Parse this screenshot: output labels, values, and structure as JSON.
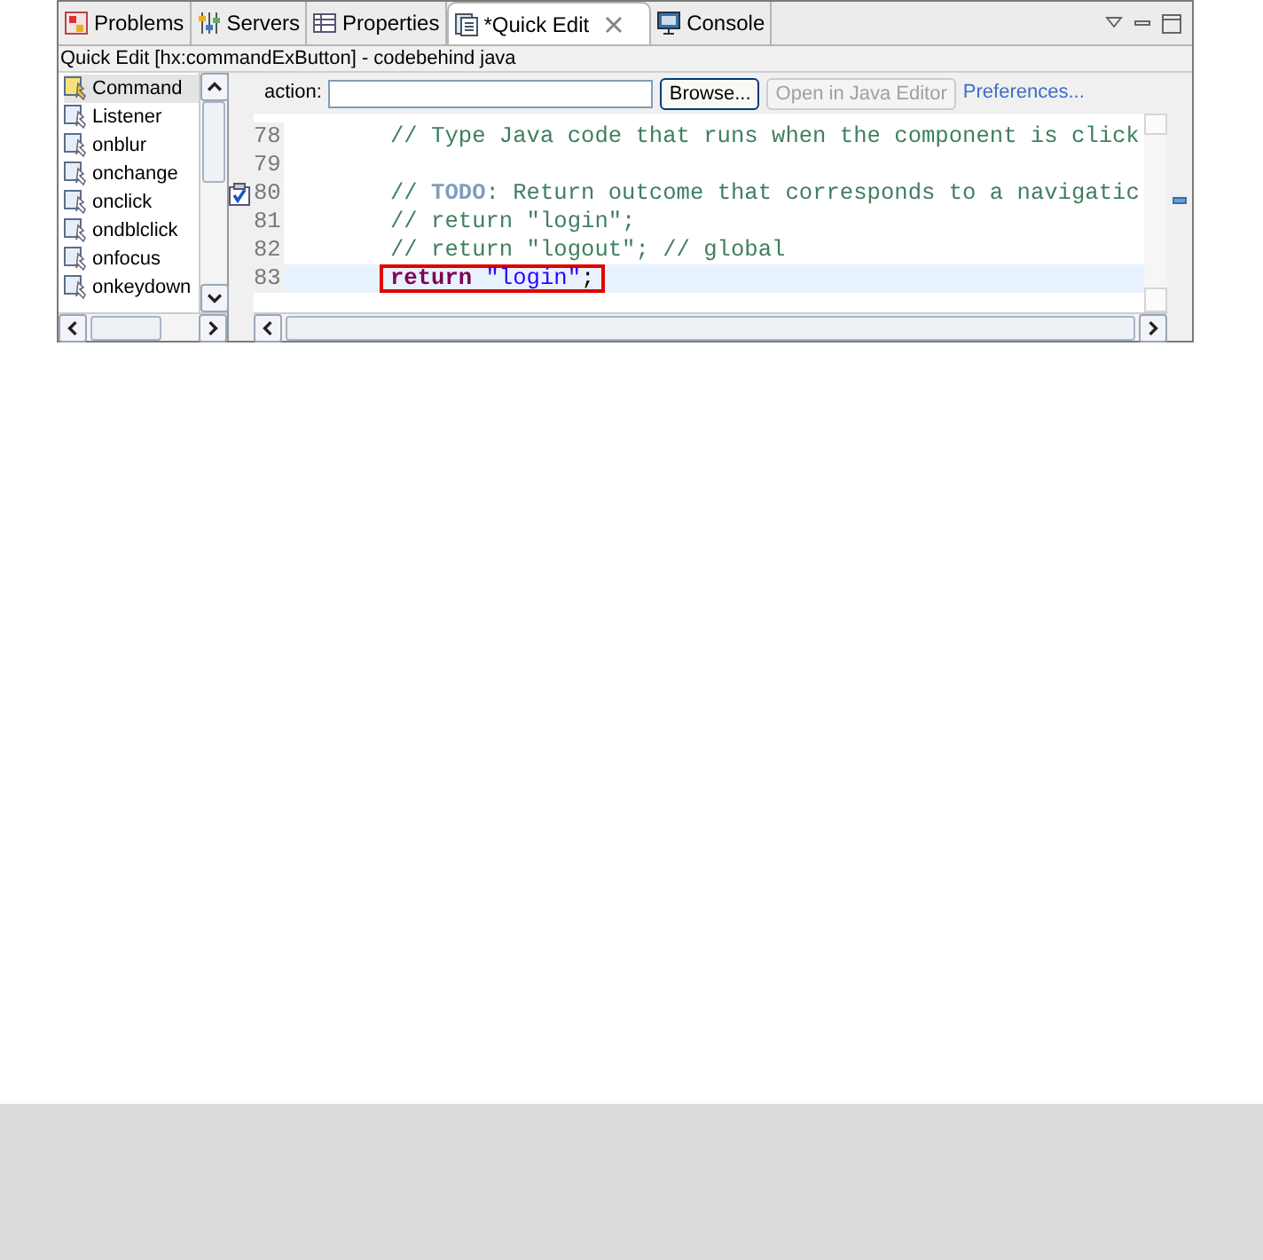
{
  "tabs": [
    {
      "label": "Problems",
      "kind": "problems",
      "selected": false,
      "closable": false
    },
    {
      "label": "Servers",
      "kind": "servers",
      "selected": false,
      "closable": false
    },
    {
      "label": "Properties",
      "kind": "properties",
      "selected": false,
      "closable": false
    },
    {
      "label": "*Quick Edit",
      "kind": "quickedit",
      "selected": true,
      "closable": true
    },
    {
      "label": "Console",
      "kind": "console",
      "selected": false,
      "closable": false
    }
  ],
  "view_title": "Quick Edit [hx:commandExButton] - codebehind java",
  "events": [
    {
      "label": "Command",
      "selected": true
    },
    {
      "label": "Listener",
      "selected": false
    },
    {
      "label": "onblur",
      "selected": false
    },
    {
      "label": "onchange",
      "selected": false
    },
    {
      "label": "onclick",
      "selected": false
    },
    {
      "label": "ondblclick",
      "selected": false
    },
    {
      "label": "onfocus",
      "selected": false
    },
    {
      "label": "onkeydown",
      "selected": false
    }
  ],
  "action_field": {
    "label": "action:"
  },
  "buttons": [
    {
      "label": "Browse...",
      "disabled": false
    },
    {
      "label": "Open in Java Editor",
      "disabled": true
    }
  ],
  "preferences_link": "Preferences...",
  "code_lines": [
    {
      "number": "78",
      "task": false,
      "current": false,
      "boxed": false,
      "segments": [
        {
          "text": "// Type Java code that runs when the component is click",
          "kind": "comment"
        }
      ]
    },
    {
      "number": "79",
      "task": false,
      "current": false
    },
    {
      "number": "80",
      "task": true,
      "current": false,
      "boxed": false,
      "segments": [
        {
          "text": "// ",
          "kind": "comment"
        },
        {
          "text": "TODO",
          "kind": "todo"
        },
        {
          "text": ": Return outcome that corresponds to a navigatic",
          "kind": "comment"
        }
      ]
    },
    {
      "number": "81",
      "task": false,
      "current": false,
      "boxed": false,
      "segments": [
        {
          "text": "// return \"login\";",
          "kind": "comment"
        }
      ]
    },
    {
      "number": "82",
      "task": false,
      "current": false,
      "boxed": false,
      "segments": [
        {
          "text": "// return \"logout\"; // global",
          "kind": "comment"
        }
      ]
    },
    {
      "number": "83",
      "task": false,
      "current": true,
      "boxed": true,
      "segments": [
        {
          "text": "return",
          "kind": "keyword"
        },
        {
          "text": " \"login\"",
          "kind": "string"
        },
        {
          "text": ";",
          "kind": "plain"
        }
      ]
    }
  ]
}
